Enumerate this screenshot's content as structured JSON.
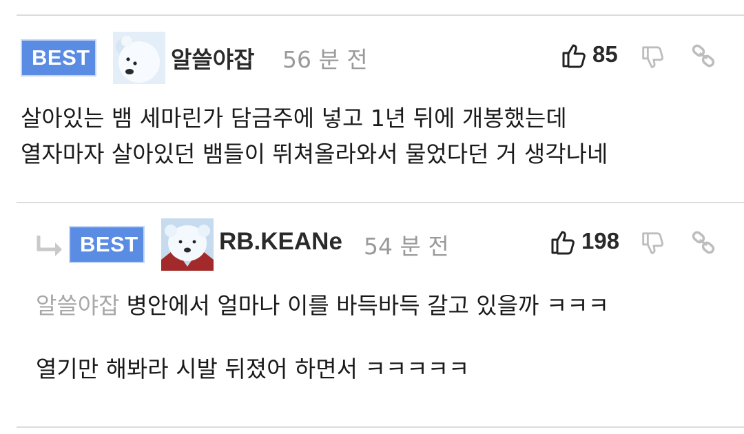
{
  "comments": [
    {
      "badge": "BEST",
      "username": "알쓸야잡",
      "time": "56 분 전",
      "likes": "85",
      "lines": [
        "살아있는 뱀 세마린가 담금주에 넣고 1년 뒤에 개봉했는데",
        "열자마자 살아있던 뱀들이 뛰쳐올라와서 물었다던 거 생각나네"
      ],
      "avatar_icon": "polar-bear-avatar"
    },
    {
      "badge": "BEST",
      "username": "RB.KEANe",
      "time": "54 분 전",
      "likes": "198",
      "mention": "알쓸야잡",
      "line1": "병안에서 얼마나 이를 바득바득 갈고 있을까 ㅋㅋㅋ",
      "line2": "열기만 해봐라 시발 뒤졌어 하면서 ㅋㅋㅋㅋㅋ",
      "avatar_icon": "polar-bear-avatar",
      "reply_icon": "reply-arrow-icon"
    }
  ],
  "colors": {
    "badge": "#5a8ce4",
    "muted": "#9a9a9a",
    "divider": "#dcdcdc"
  }
}
